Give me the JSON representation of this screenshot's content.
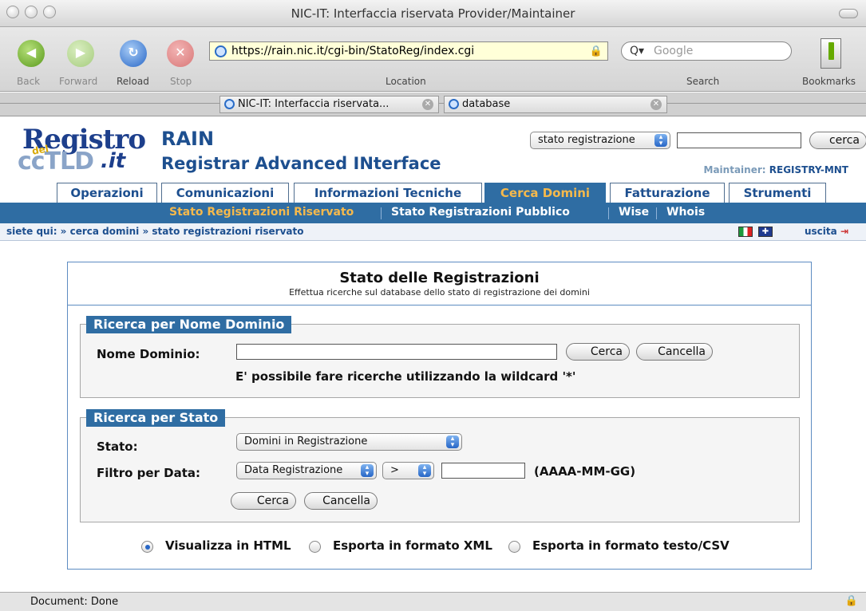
{
  "window": {
    "title": "NIC-IT: Interfaccia riservata Provider/Maintainer"
  },
  "toolbar": {
    "back": "Back",
    "forward": "Forward",
    "reload": "Reload",
    "stop": "Stop",
    "url": "https://rain.nic.it/cgi-bin/StatoReg/index.cgi",
    "location_label": "Location",
    "search_placeholder": "Google",
    "search_label": "Search",
    "bookmarks_label": "Bookmarks"
  },
  "tabs": [
    {
      "label": "NIC-IT: Interfaccia riservata..."
    },
    {
      "label": "database"
    }
  ],
  "header": {
    "logo_main": "Registro",
    "logo_del": "del",
    "logo_cctld": "ccTLD",
    "logo_it": ".it",
    "title": "RAIN",
    "subtitle": "Registrar Advanced INterface",
    "search_select": "stato registrazione",
    "search_button": "cerca",
    "maintainer_label": "Maintainer:",
    "maintainer_value": "REGISTRY-MNT"
  },
  "main_tabs": [
    "Operazioni",
    "Comunicazioni",
    "Informazioni Tecniche",
    "Cerca Domini",
    "Fatturazione",
    "Strumenti"
  ],
  "sub_nav": [
    "Stato Registrazioni Riservato",
    "Stato Registrazioni Pubblico",
    "Wise",
    "Whois"
  ],
  "breadcrumb": {
    "text": "siete qui: » cerca domini » stato registrazioni riservato",
    "exit": "uscita"
  },
  "panel": {
    "title": "Stato delle Registrazioni",
    "subtitle": "Effettua ricerche sul database dello stato di registrazione dei domini",
    "domain_search": {
      "legend": "Ricerca per Nome Dominio",
      "label": "Nome Dominio:",
      "search_button": "Cerca",
      "cancel_button": "Cancella",
      "hint": "E' possibile fare ricerche utilizzando la wildcard '*'"
    },
    "state_search": {
      "legend": "Ricerca per Stato",
      "state_label": "Stato:",
      "state_value": "Domini in Registrazione",
      "filter_label": "Filtro per Data:",
      "filter_value": "Data Registrazione",
      "operator_value": ">",
      "date_format": "(AAAA-MM-GG)",
      "search_button": "Cerca",
      "cancel_button": "Cancella"
    },
    "output_options": [
      "Visualizza in HTML",
      "Esporta in formato XML",
      "Esporta in formato testo/CSV"
    ]
  },
  "status_bar": {
    "text": "Document: Done"
  },
  "colors": {
    "brand_blue": "#2f6da3",
    "active_tab_text": "#f5b94c",
    "url_bg": "#ffffd8"
  }
}
